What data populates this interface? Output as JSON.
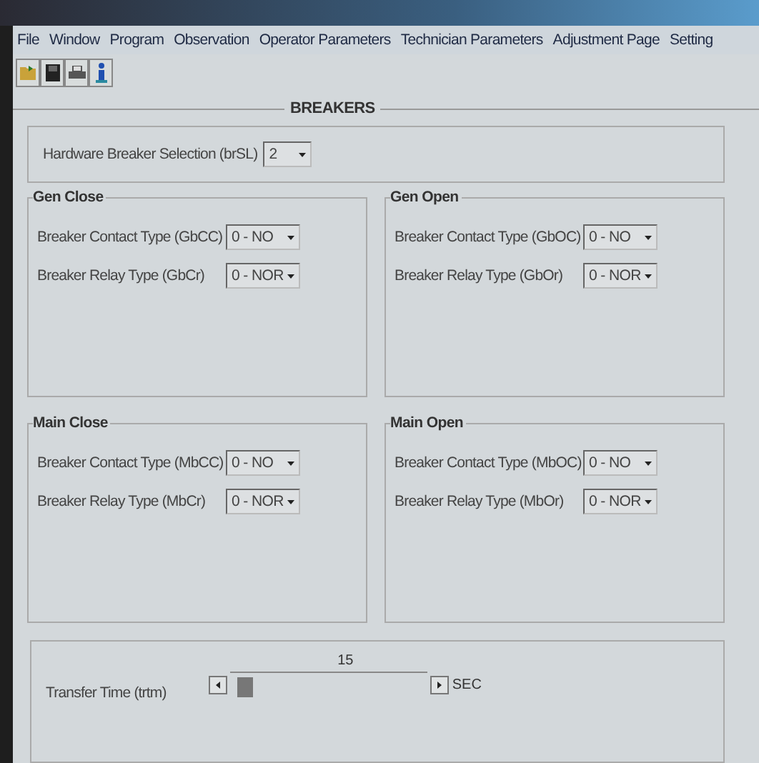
{
  "menu": [
    "File",
    "Window",
    "Program",
    "Observation",
    "Operator Parameters",
    "Technician Parameters",
    "Adjustment Page",
    "Setting"
  ],
  "page_title": "BREAKERS",
  "hardware": {
    "label": "Hardware Breaker Selection (brSL)",
    "value": "2"
  },
  "groups": [
    {
      "title": "Gen Close",
      "fields": [
        {
          "label": "Breaker Contact Type (GbCC)",
          "value": "0 - NO"
        },
        {
          "label": "Breaker Relay Type (GbCr)",
          "value": "0 - NOR"
        }
      ]
    },
    {
      "title": "Gen Open",
      "fields": [
        {
          "label": "Breaker Contact Type (GbOC)",
          "value": "0 - NO"
        },
        {
          "label": "Breaker Relay Type (GbOr)",
          "value": "0 - NOR"
        }
      ]
    },
    {
      "title": "Main Close",
      "fields": [
        {
          "label": "Breaker Contact Type (MbCC)",
          "value": "0 - NO"
        },
        {
          "label": "Breaker Relay Type (MbCr)",
          "value": "0 - NOR"
        }
      ]
    },
    {
      "title": "Main Open",
      "fields": [
        {
          "label": "Breaker Contact Type (MbOC)",
          "value": "0 - NO"
        },
        {
          "label": "Breaker Relay Type (MbOr)",
          "value": "0 - NOR"
        }
      ]
    }
  ],
  "transfer": {
    "label": "Transfer Time (trtm)",
    "reading": "15",
    "level": 0.04,
    "unit": "SEC"
  }
}
